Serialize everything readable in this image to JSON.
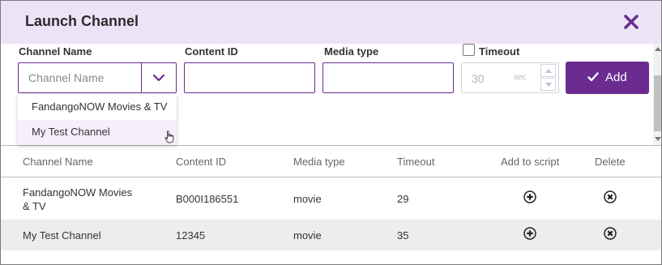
{
  "dialog": {
    "title": "Launch Channel",
    "close_icon": "close-x-icon",
    "accent_color": "#6a2c91"
  },
  "form": {
    "channel_name_label": "Channel Name",
    "channel_name_placeholder": "Channel Name",
    "content_id_label": "Content ID",
    "content_id_value": "",
    "media_type_label": "Media type",
    "media_type_value": "",
    "timeout_label": "Timeout",
    "timeout_checked": false,
    "timeout_value": "30",
    "timeout_unit": "sec",
    "add_label": "Add"
  },
  "dropdown": {
    "options": [
      "FandangoNOW Movies & TV",
      "My Test Channel"
    ],
    "hovered": "My Test Channel"
  },
  "table": {
    "headers": [
      "Channel Name",
      "Content ID",
      "Media type",
      "Timeout",
      "Add to script",
      "Delete"
    ],
    "rows": [
      {
        "channel_name_line1": "FandangoNOW Movies",
        "channel_name_line2": "& TV",
        "content_id": "B000I186551",
        "media_type": "movie",
        "timeout": "29",
        "add_icon": "plus-circle-icon",
        "delete_icon": "x-circle-icon"
      },
      {
        "channel_name_line1": "My Test Channel",
        "channel_name_line2": "",
        "content_id": "12345",
        "media_type": "movie",
        "timeout": "35",
        "add_icon": "plus-circle-icon",
        "delete_icon": "x-circle-icon"
      }
    ]
  }
}
